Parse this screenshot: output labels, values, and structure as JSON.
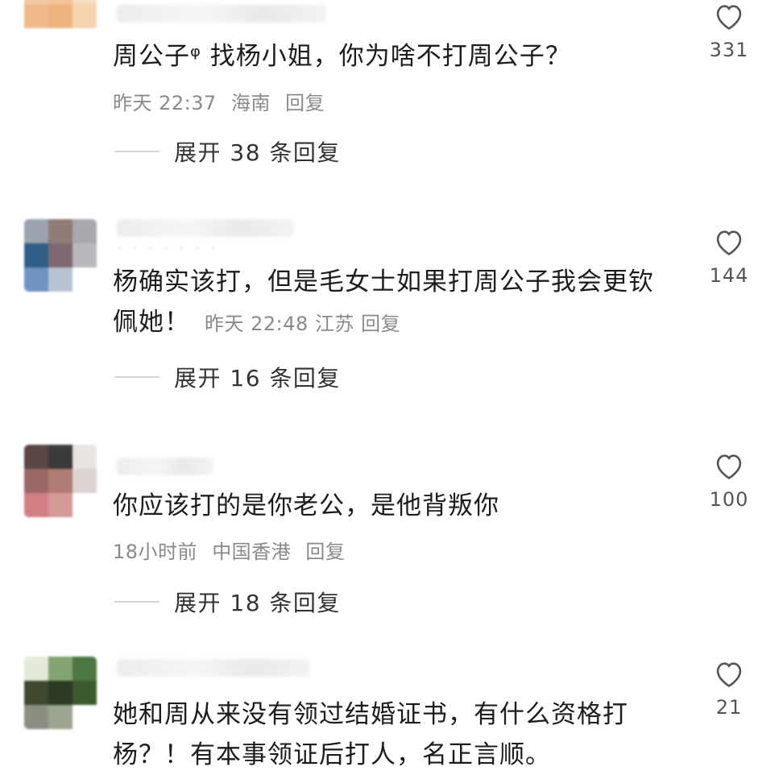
{
  "comments": [
    {
      "text": "周公子ᵠ 找杨小姐，你为啥不打周公子？",
      "time": "昨天 22:37",
      "location": "海南",
      "reply": "回复",
      "expand": "展开 38 条回复",
      "likes": "331",
      "avatar_colors": [
        "#f3c9a1",
        "#f2c397",
        "#f7dcc0",
        "#f0b98a",
        "#eeb27f",
        "#f5d2b0",
        "#ffffff",
        "#ffffff",
        "#ffffff"
      ]
    },
    {
      "text": "杨确实该打，但是毛女士如果打周公子我会更钦佩她！",
      "time": "昨天 22:48",
      "location": "江苏",
      "reply": "回复",
      "expand": "展开 16 条回复",
      "likes": "144",
      "avatar_colors": [
        "#9aa3ae",
        "#8f7c74",
        "#a9a9ad",
        "#2f5f86",
        "#7e6a72",
        "#b8b8bc",
        "#6f93c0",
        "#b7c2d2",
        "#ffffff"
      ]
    },
    {
      "text": "你应该打的是你老公，是他背叛你",
      "time": "18小时前",
      "location": "中国香港",
      "reply": "回复",
      "expand": "展开 18 条回复",
      "likes": "100",
      "avatar_colors": [
        "#5a4645",
        "#3c3a3c",
        "#e9e4e2",
        "#9b6766",
        "#b07c74",
        "#dcd3d1",
        "#d17f85",
        "#d49a98",
        "#ffffff"
      ]
    },
    {
      "text": "她和周从来没有领过结婚证书，有什么资格打杨？！有本事领证后打人，名正言顺。",
      "likes": "21",
      "avatar_colors": [
        "#e4ead9",
        "#83a370",
        "#4f7741",
        "#3f4a2e",
        "#2c3a23",
        "#3b5a2d",
        "#8b8f82",
        "#9aa48f",
        "#ffffff"
      ]
    }
  ],
  "colors": {
    "text": "#1c1c1c",
    "meta": "#8a8a8a",
    "like_icon": "#555555",
    "divider": "#d6d6d6"
  },
  "icons": {
    "like": "heart-outline-icon"
  }
}
